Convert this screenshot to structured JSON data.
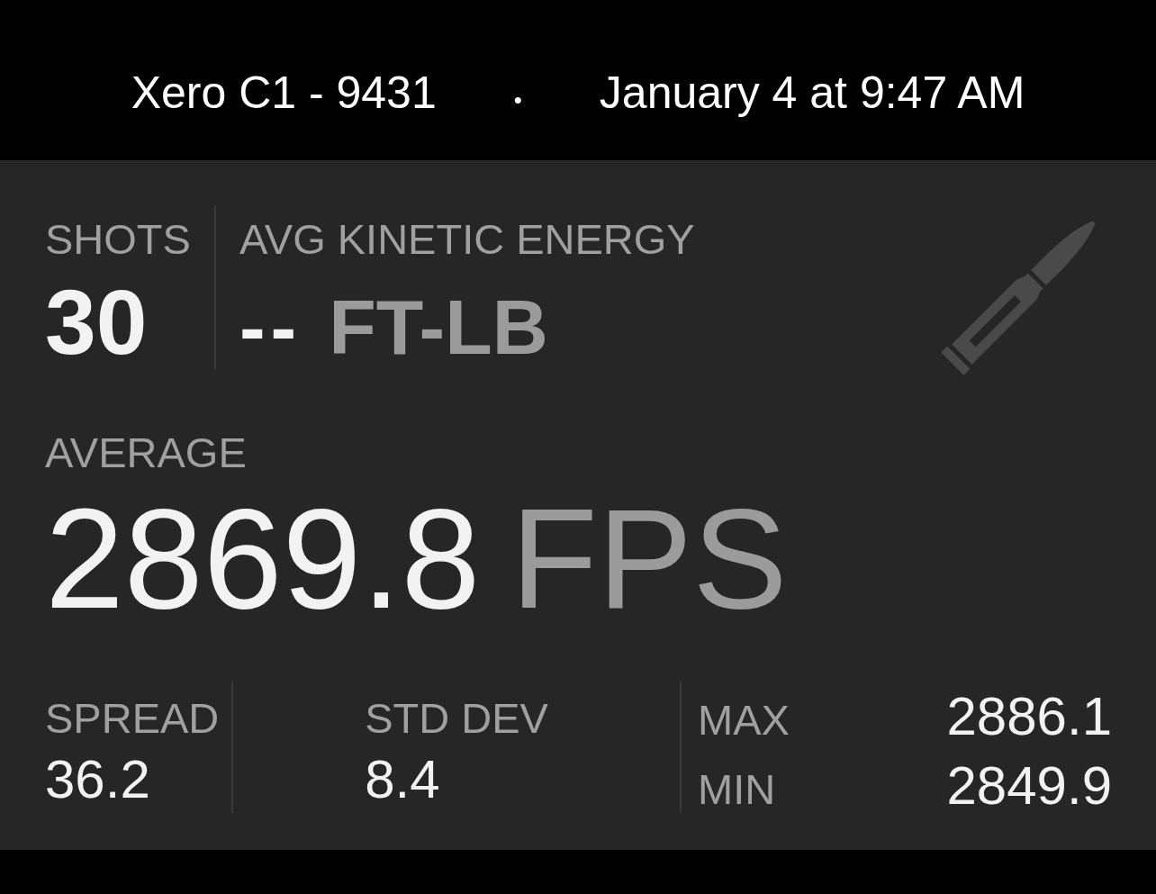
{
  "header": {
    "device": "Xero C1 - 9431",
    "separator": "•",
    "timestamp": "January 4 at 9:47 AM"
  },
  "summary": {
    "shots": {
      "label": "SHOTS",
      "value": "30"
    },
    "kinetic_energy": {
      "label": "AVG KINETIC ENERGY",
      "value": "--",
      "unit": "FT-LB"
    }
  },
  "average": {
    "label": "AVERAGE",
    "value": "2869.8",
    "unit": "FPS"
  },
  "stats": [
    {
      "label": "SPREAD",
      "value": "36.2"
    },
    {
      "label": "STD DEV",
      "value": "8.4"
    }
  ],
  "extremes": [
    {
      "label": "MAX",
      "value": "2886.1"
    },
    {
      "label": "MIN",
      "value": "2849.9"
    }
  ]
}
